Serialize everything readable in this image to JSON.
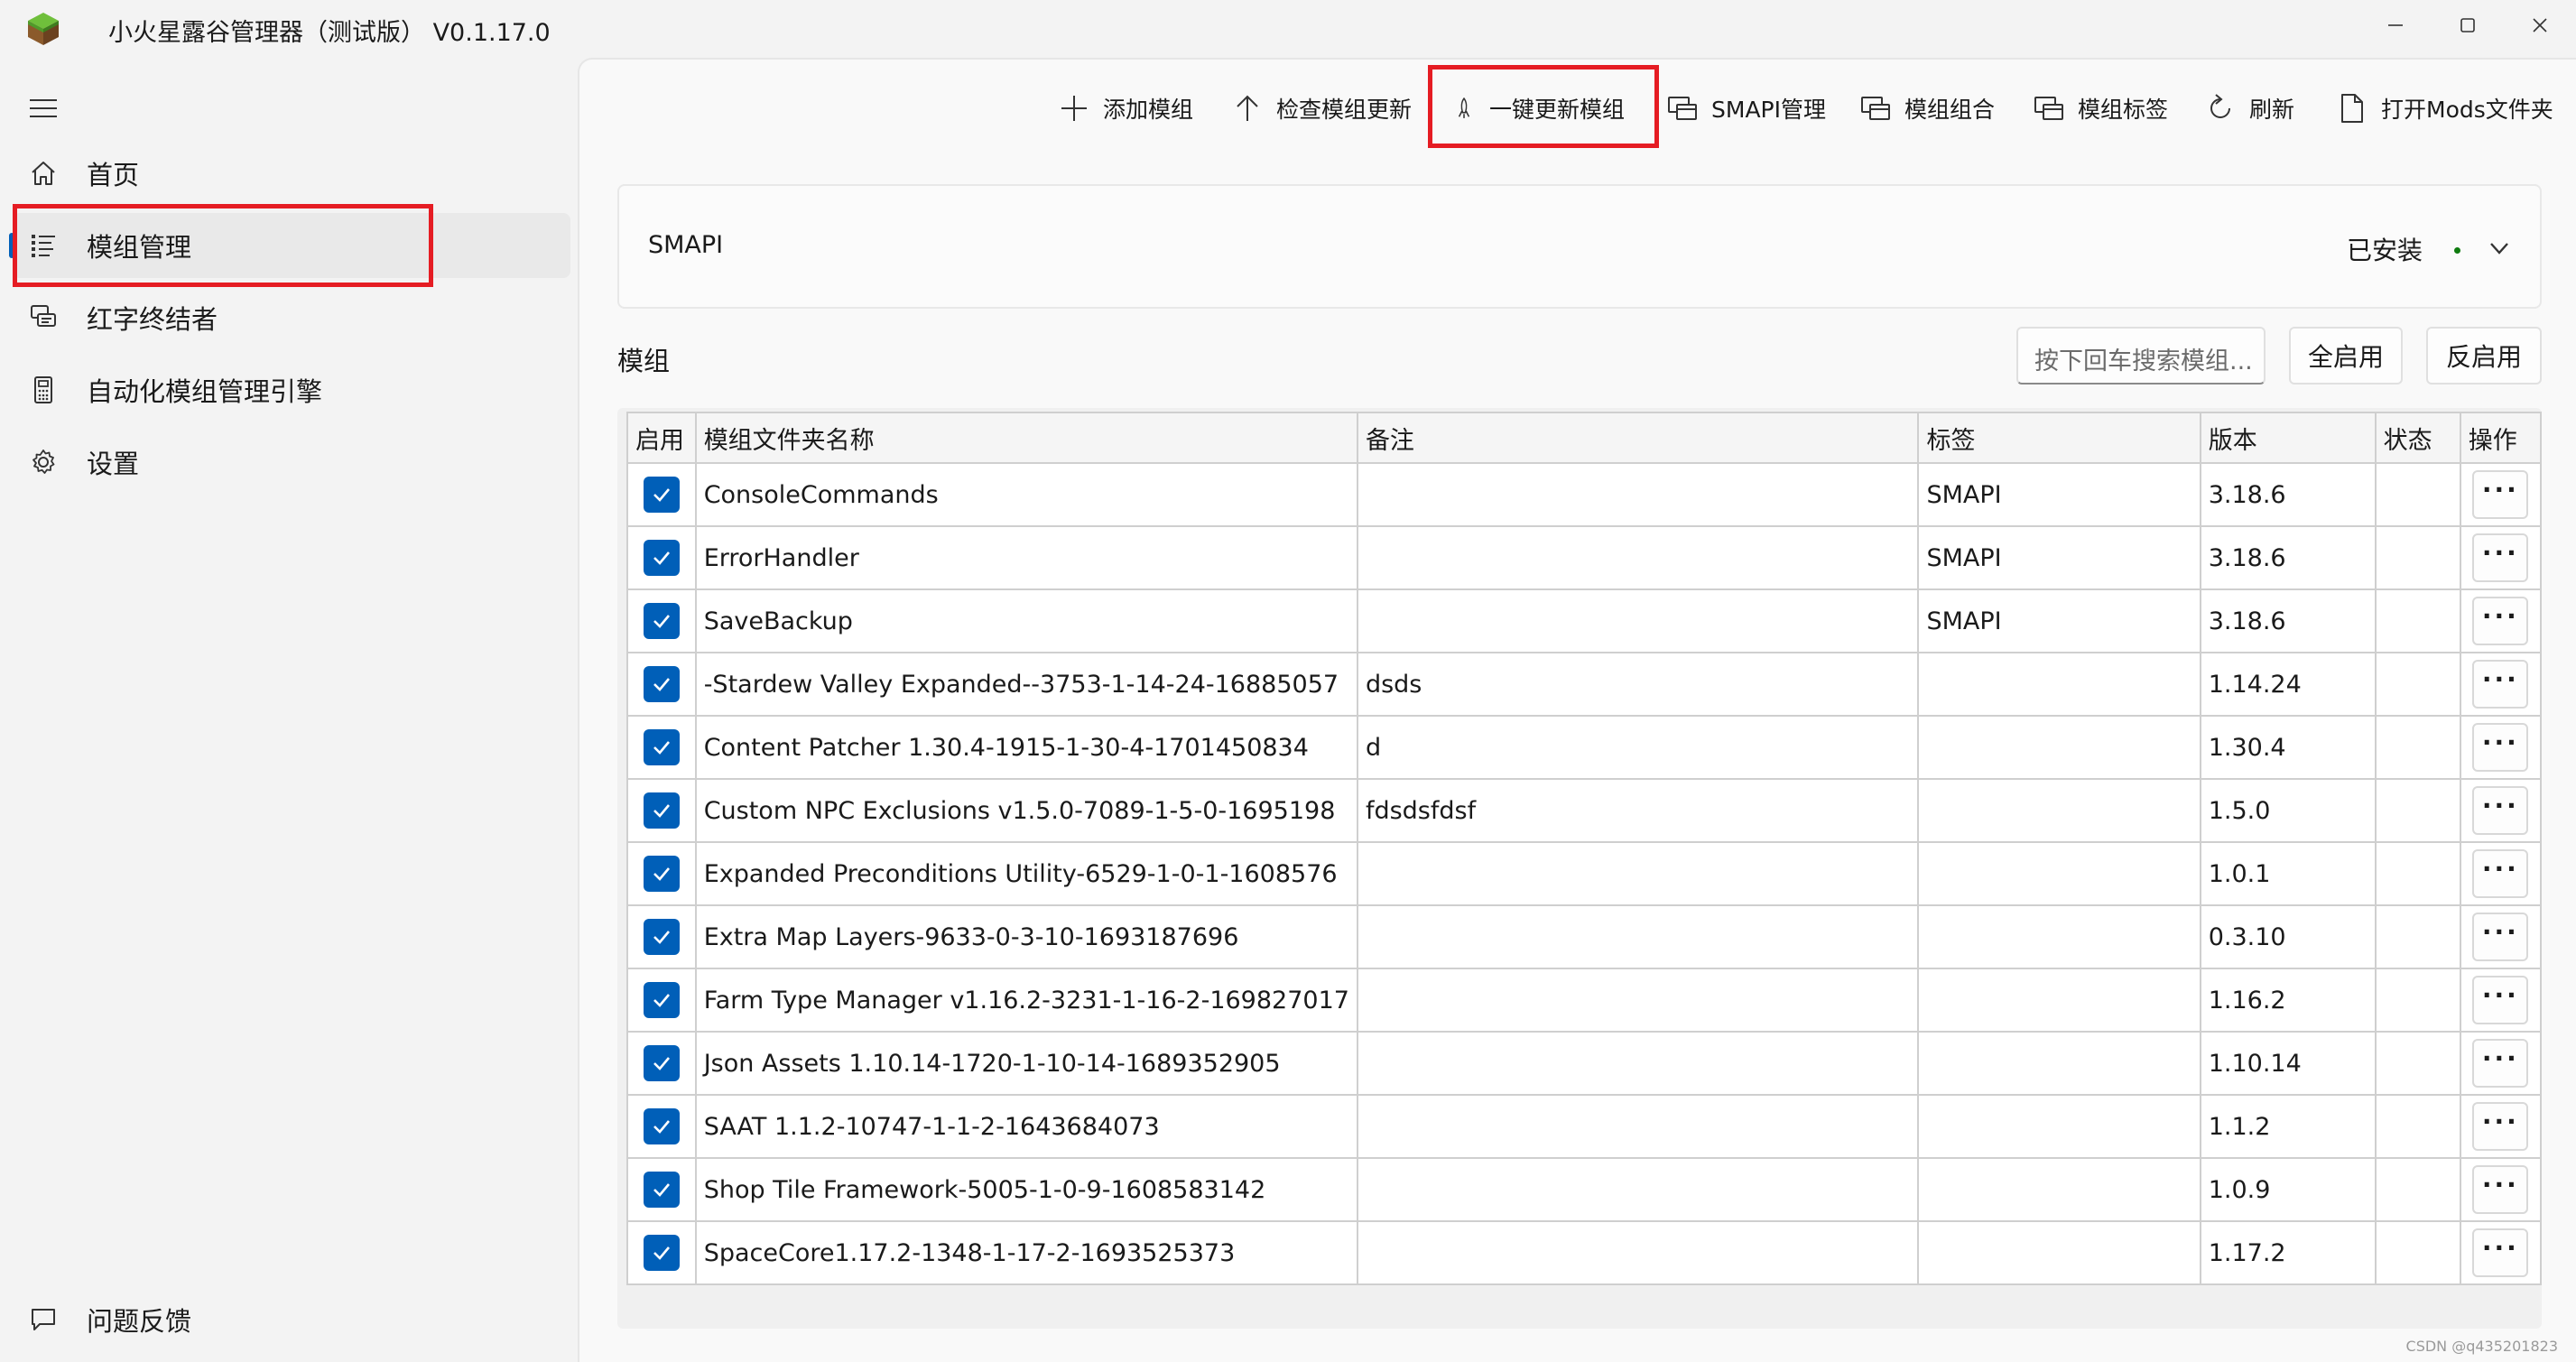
{
  "window": {
    "title": "小火星露谷管理器（测试版） V0.1.17.0"
  },
  "sidebar": {
    "items": [
      {
        "label": "首页",
        "icon": "home-icon"
      },
      {
        "label": "模组管理",
        "icon": "list-icon",
        "active": true
      },
      {
        "label": "红字终结者",
        "icon": "chat-icon"
      },
      {
        "label": "自动化模组管理引擎",
        "icon": "calculator-icon"
      },
      {
        "label": "设置",
        "icon": "gear-icon"
      }
    ],
    "feedback_label": "问题反馈"
  },
  "toolbar": {
    "add_mod": "添加模组",
    "check_updates": "检查模组更新",
    "one_click_update": "一键更新模组",
    "smapi_manage": "SMAPI管理",
    "mod_groups": "模组组合",
    "mod_tags": "模组标签",
    "refresh": "刷新",
    "open_mods_folder": "打开Mods文件夹"
  },
  "smapi": {
    "name": "SMAPI",
    "status": "已安装"
  },
  "mods_section": {
    "title": "模组",
    "search_placeholder": "按下回车搜索模组...",
    "enable_all": "全启用",
    "invert_enable": "反启用"
  },
  "table": {
    "headers": [
      "启用",
      "模组文件夹名称",
      "备注",
      "标签",
      "版本",
      "状态",
      "操作"
    ],
    "more_label": "···",
    "rows": [
      {
        "enabled": true,
        "name": "ConsoleCommands",
        "note": "",
        "tag": "SMAPI",
        "version": "3.18.6",
        "status": ""
      },
      {
        "enabled": true,
        "name": "ErrorHandler",
        "note": "",
        "tag": "SMAPI",
        "version": "3.18.6",
        "status": ""
      },
      {
        "enabled": true,
        "name": "SaveBackup",
        "note": "",
        "tag": "SMAPI",
        "version": "3.18.6",
        "status": ""
      },
      {
        "enabled": true,
        "name": "-Stardew Valley Expanded--3753-1-14-24-16885057",
        "note": "dsds",
        "tag": "",
        "version": "1.14.24",
        "status": ""
      },
      {
        "enabled": true,
        "name": "Content Patcher 1.30.4-1915-1-30-4-1701450834",
        "note": "d",
        "tag": "",
        "version": "1.30.4",
        "status": ""
      },
      {
        "enabled": true,
        "name": "Custom NPC Exclusions v1.5.0-7089-1-5-0-1695198",
        "note": "fdsdsfdsf",
        "tag": "",
        "version": "1.5.0",
        "status": ""
      },
      {
        "enabled": true,
        "name": "Expanded Preconditions Utility-6529-1-0-1-1608576",
        "note": "",
        "tag": "",
        "version": "1.0.1",
        "status": ""
      },
      {
        "enabled": true,
        "name": "Extra Map Layers-9633-0-3-10-1693187696",
        "note": "",
        "tag": "",
        "version": "0.3.10",
        "status": ""
      },
      {
        "enabled": true,
        "name": "Farm Type Manager v1.16.2-3231-1-16-2-169827017",
        "note": "",
        "tag": "",
        "version": "1.16.2",
        "status": ""
      },
      {
        "enabled": true,
        "name": "Json Assets 1.10.14-1720-1-10-14-1689352905",
        "note": "",
        "tag": "",
        "version": "1.10.14",
        "status": ""
      },
      {
        "enabled": true,
        "name": "SAAT 1.1.2-10747-1-1-2-1643684073",
        "note": "",
        "tag": "",
        "version": "1.1.2",
        "status": ""
      },
      {
        "enabled": true,
        "name": "Shop Tile Framework-5005-1-0-9-1608583142",
        "note": "",
        "tag": "",
        "version": "1.0.9",
        "status": ""
      },
      {
        "enabled": true,
        "name": "SpaceCore1.17.2-1348-1-17-2-1693525373",
        "note": "",
        "tag": "",
        "version": "1.17.2",
        "status": ""
      }
    ]
  },
  "watermark": "CSDN @q435201823",
  "colors": {
    "accent": "#005fb8",
    "highlight_box": "#e51c23",
    "installed_dot": "#0f7b0f"
  }
}
